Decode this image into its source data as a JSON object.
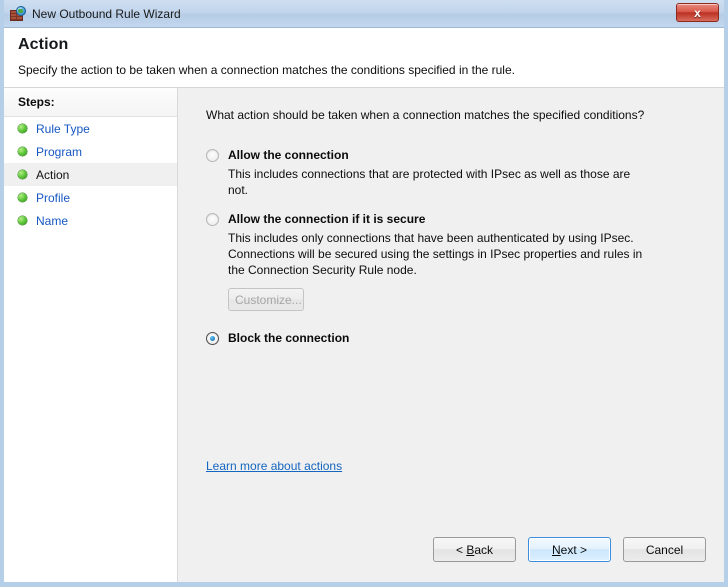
{
  "window": {
    "title": "New Outbound Rule Wizard",
    "icon": "firewall-globe-icon",
    "close_label": "x"
  },
  "header": {
    "title": "Action",
    "subtitle": "Specify the action to be taken when a connection matches the conditions specified in the rule."
  },
  "sidebar": {
    "header": "Steps:",
    "items": [
      {
        "label": "Rule Type",
        "current": false
      },
      {
        "label": "Program",
        "current": false
      },
      {
        "label": "Action",
        "current": true
      },
      {
        "label": "Profile",
        "current": false
      },
      {
        "label": "Name",
        "current": false
      }
    ]
  },
  "main": {
    "question": "What action should be taken when a connection matches the specified conditions?",
    "options": [
      {
        "label": "Allow the connection",
        "description": "This includes connections that are protected with IPsec as well as those are not.",
        "selected": false
      },
      {
        "label": "Allow the connection if it is secure",
        "description": "This includes only connections that have been authenticated by using IPsec.  Connections will be secured using the settings in IPsec properties and rules in the Connection Security Rule node.",
        "selected": false
      },
      {
        "label": "Block the connection",
        "description": "",
        "selected": true
      }
    ],
    "customize_label": "Customize...",
    "learn_more_label": "Learn more about actions"
  },
  "buttons": {
    "back_prefix": "< ",
    "back_accel": "B",
    "back_suffix": "ack",
    "next_prefix": "",
    "next_accel": "N",
    "next_suffix": "ext >",
    "cancel": "Cancel"
  },
  "colors": {
    "titlebar": "#c2d5ec",
    "close_red": "#bb3124",
    "link_blue": "#1566c0",
    "step_link_blue": "#1657c2",
    "radio_blue": "#2a8fd0",
    "bullet_green": "#5fc83c",
    "panel_gray": "#f0f0f0"
  }
}
